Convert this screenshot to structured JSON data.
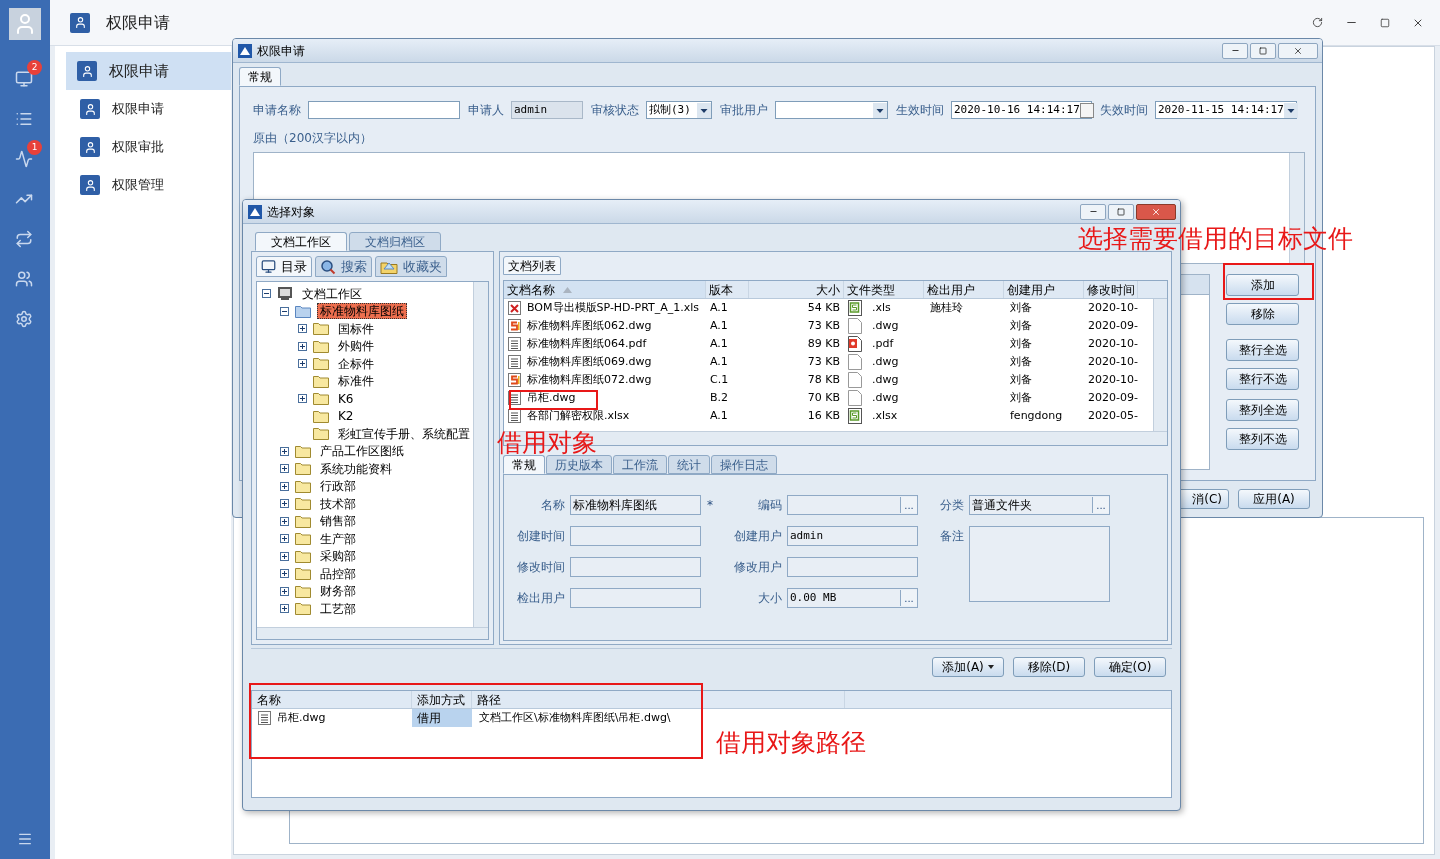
{
  "app": {
    "title": "权限申请"
  },
  "rail": {
    "items": [
      {
        "kind": "monitor",
        "badge": "2"
      },
      {
        "kind": "list"
      },
      {
        "kind": "chart",
        "badge": "1"
      },
      {
        "kind": "stairs"
      },
      {
        "kind": "swap"
      },
      {
        "kind": "users"
      },
      {
        "kind": "gear"
      }
    ]
  },
  "nav": {
    "items": [
      {
        "label": "权限申请",
        "selected": true
      },
      {
        "label": "权限申请",
        "selected": false
      },
      {
        "label": "权限审批",
        "selected": false
      },
      {
        "label": "权限管理",
        "selected": false
      }
    ]
  },
  "request_dialog": {
    "title": "权限申请",
    "tabs": [
      {
        "label": "常规",
        "selected": true
      }
    ],
    "fields": [
      {
        "label": "申请名称",
        "kind": "text"
      },
      {
        "label": "申请人",
        "kind": "readonly",
        "value": "admin"
      },
      {
        "label": "审核状态",
        "kind": "select",
        "value": "拟制(3)"
      },
      {
        "label": "审批用户",
        "kind": "select"
      },
      {
        "label": "生效时间",
        "kind": "date",
        "value": "2020-10-16 14:14:17"
      },
      {
        "label": "失效时间",
        "kind": "select",
        "value": "2020-11-15 14:14:17"
      }
    ],
    "reason_label": "原由（200汉字以内）",
    "side_buttons": [
      "添加",
      "移除",
      "整行全选",
      "整行不选",
      "整列全选",
      "整列不选"
    ],
    "footer_buttons": [
      "消(C)",
      "应用(A)"
    ]
  },
  "select_dialog": {
    "title": "选择对象",
    "tabs": [
      {
        "label": "文档工作区",
        "selected": true
      },
      {
        "label": "文档归档区",
        "selected": false
      }
    ],
    "subtabs": [
      {
        "kind": "monitor",
        "label": "目录",
        "selected": true
      },
      {
        "kind": "search",
        "label": "搜索",
        "selected": false
      },
      {
        "kind": "favorites",
        "label": "收藏夹",
        "selected": false
      }
    ],
    "tree": [
      {
        "label": "文档工作区",
        "kind": "computer",
        "expanded": true,
        "selected": false,
        "children": [
          {
            "label": "标准物料库图纸",
            "kind": "folder",
            "expanded": true,
            "selected": true,
            "children": [
              {
                "label": "国标件",
                "kind": "folder",
                "expanded": false,
                "selected": false
              },
              {
                "label": "外购件",
                "kind": "folder",
                "expanded": false,
                "selected": false
              },
              {
                "label": "企标件",
                "kind": "folder",
                "expanded": false,
                "selected": false
              },
              {
                "label": "标准件",
                "kind": "folder",
                "selected": false
              },
              {
                "label": "K6",
                "kind": "folder",
                "expanded": false,
                "selected": false
              },
              {
                "label": "K2",
                "kind": "folder",
                "selected": false
              },
              {
                "label": "彩虹宣传手册、系统配置",
                "kind": "folder",
                "selected": false
              }
            ]
          },
          {
            "label": "产品工作区图纸",
            "kind": "folder",
            "expanded": false,
            "selected": false
          },
          {
            "label": "系统功能资料",
            "kind": "folder",
            "expanded": false,
            "selected": false
          },
          {
            "label": "行政部",
            "kind": "folder",
            "expanded": false,
            "selected": false
          },
          {
            "label": "技术部",
            "kind": "folder",
            "expanded": false,
            "selected": false
          },
          {
            "label": "销售部",
            "kind": "folder",
            "expanded": false,
            "selected": false
          },
          {
            "label": "生产部",
            "kind": "folder",
            "expanded": false,
            "selected": false
          },
          {
            "label": "采购部",
            "kind": "folder",
            "expanded": false,
            "selected": false
          },
          {
            "label": "品控部",
            "kind": "folder",
            "expanded": false,
            "selected": false
          },
          {
            "label": "财务部",
            "kind": "folder",
            "expanded": false,
            "selected": false
          },
          {
            "label": "工艺部",
            "kind": "folder",
            "expanded": false,
            "selected": false
          }
        ]
      }
    ],
    "list_tab": "文档列表",
    "columns": [
      {
        "label": "文档名称",
        "sorted": true
      },
      {
        "label": "版本",
        "sorted": false
      },
      {
        "label": "大小",
        "sorted": false
      },
      {
        "label": "文件类型",
        "sorted": false
      },
      {
        "label": "检出用户",
        "sorted": false
      },
      {
        "label": "创建用户",
        "sorted": false
      },
      {
        "label": "修改时间",
        "sorted": false
      }
    ],
    "rows": [
      {
        "kind": "xls",
        "name": "BOM导出模版SP-HD-PRT_A_1.xls",
        "version": "A.1",
        "size": "54 KB",
        "type": {
          "kind": "sheet",
          "text": ".xls"
        },
        "checkout": "施桂玲",
        "creator": "刘备",
        "modified": "2020-10-"
      },
      {
        "kind": "s",
        "name": "标准物料库图纸062.dwg",
        "version": "A.1",
        "size": "73 KB",
        "type": {
          "kind": "blank",
          "text": ".dwg"
        },
        "creator": "刘备",
        "modified": "2020-09-"
      },
      {
        "kind": "doc",
        "name": "标准物料库图纸064.pdf",
        "version": "A.1",
        "size": "89 KB",
        "type": {
          "kind": "pdf",
          "text": ".pdf"
        },
        "creator": "刘备",
        "modified": "2020-10-"
      },
      {
        "kind": "doc",
        "name": "标准物料库图纸069.dwg",
        "version": "A.1",
        "size": "73 KB",
        "type": {
          "kind": "blank",
          "text": ".dwg"
        },
        "creator": "刘备",
        "modified": "2020-10-"
      },
      {
        "kind": "s",
        "name": "标准物料库图纸072.dwg",
        "version": "C.1",
        "size": "78 KB",
        "type": {
          "kind": "blank",
          "text": ".dwg"
        },
        "creator": "刘备",
        "modified": "2020-10-"
      },
      {
        "kind": "doc",
        "name": "吊柜.dwg",
        "version": "B.2",
        "size": "70 KB",
        "type": {
          "kind": "blank",
          "text": ".dwg"
        },
        "creator": "刘备",
        "modified": "2020-09-"
      },
      {
        "kind": "doc",
        "name": "各部门解密权限.xlsx",
        "version": "A.1",
        "size": "16 KB",
        "type": {
          "kind": "sheet",
          "text": ".xlsx"
        },
        "creator": "fengdong",
        "modified": "2020-05-"
      }
    ],
    "detail_tabs": [
      {
        "label": "常规",
        "selected": true
      },
      {
        "label": "历史版本",
        "selected": false
      },
      {
        "label": "工作流",
        "selected": false
      },
      {
        "label": "统计",
        "selected": false
      },
      {
        "label": "操作日志",
        "selected": false
      }
    ],
    "detail_columns": [
      [
        {
          "label": "名称",
          "kind": "text",
          "value": "标准物料库图纸",
          "marker": "*"
        },
        {
          "label": "创建时间",
          "kind": "text"
        },
        {
          "label": "修改时间",
          "kind": "text"
        },
        {
          "label": "检出用户",
          "kind": "text"
        }
      ],
      [
        {
          "label": "编码",
          "kind": "text",
          "button": "..."
        },
        {
          "label": "创建用户",
          "kind": "text",
          "value": "admin"
        },
        {
          "label": "修改用户",
          "kind": "text"
        },
        {
          "label": "大小",
          "kind": "text",
          "value": "0.00 MB",
          "button": "..."
        }
      ],
      [
        {
          "label": "分类",
          "kind": "text",
          "value": "普通文件夹",
          "button": "..."
        },
        {
          "label": "备注",
          "kind": "textarea"
        }
      ]
    ],
    "action_buttons": [
      {
        "label": "添加(A)",
        "menu": true
      },
      {
        "label": "移除(D)",
        "menu": false
      },
      {
        "label": "确定(O)",
        "menu": false
      }
    ],
    "picked": {
      "columns": [
        "名称",
        "添加方式",
        "路径"
      ],
      "rows": [
        {
          "name": "吊柜.dwg",
          "mode": "借用",
          "path": "文档工作区\\标准物料库图纸\\吊柜.dwg\\"
        }
      ]
    }
  },
  "annotations": [
    {
      "text": "选择需要借用的目标文件"
    },
    {
      "text": "借用对象"
    },
    {
      "text": "借用对象路径"
    }
  ]
}
